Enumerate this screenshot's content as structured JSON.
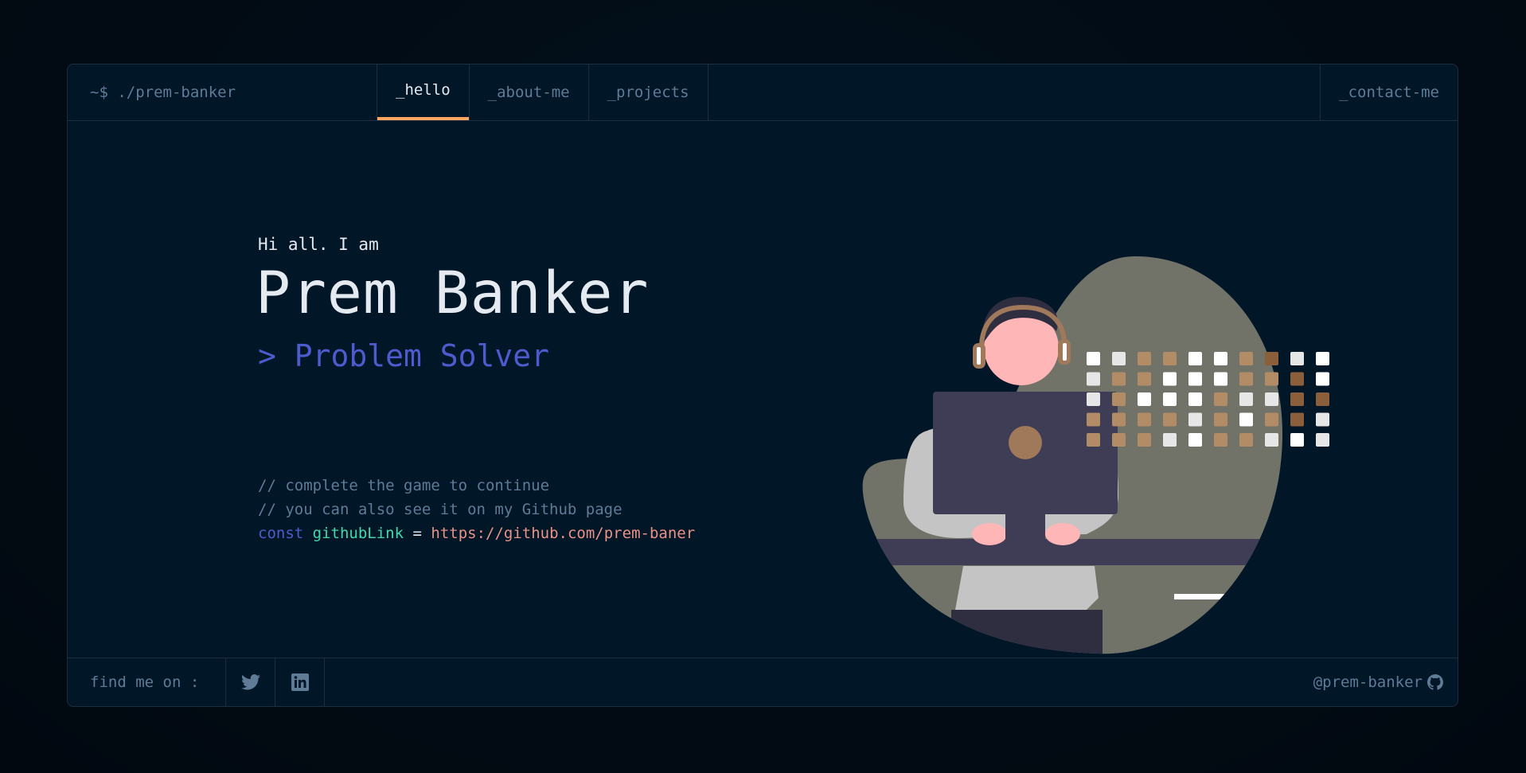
{
  "header": {
    "brand": "~$ ./prem-banker",
    "tabs": [
      {
        "label": "_hello",
        "active": true
      },
      {
        "label": "_about-me",
        "active": false
      },
      {
        "label": "_projects",
        "active": false
      }
    ],
    "contact": "_contact-me"
  },
  "hero": {
    "greeting": "Hi all. I am",
    "name": "Prem Banker",
    "role": "> Problem Solver",
    "comment1": "// complete the game to continue",
    "comment2": "// you can also see it on my Github page",
    "code": {
      "keyword": "const",
      "variable": "githubLink",
      "operator": "=",
      "value": "https://github.com/prem-baner"
    }
  },
  "footer": {
    "find_label": "find me on :",
    "socials": [
      {
        "name": "twitter",
        "icon": "twitter-icon"
      },
      {
        "name": "linkedin",
        "icon": "linkedin-icon"
      }
    ],
    "github_handle": "@prem-banker"
  },
  "colors": {
    "accent_orange": "#fea55f",
    "accent_blue": "#4d5bce",
    "accent_green": "#43d9ad",
    "accent_salmon": "#e99287",
    "muted": "#607b96",
    "background": "#011627"
  }
}
